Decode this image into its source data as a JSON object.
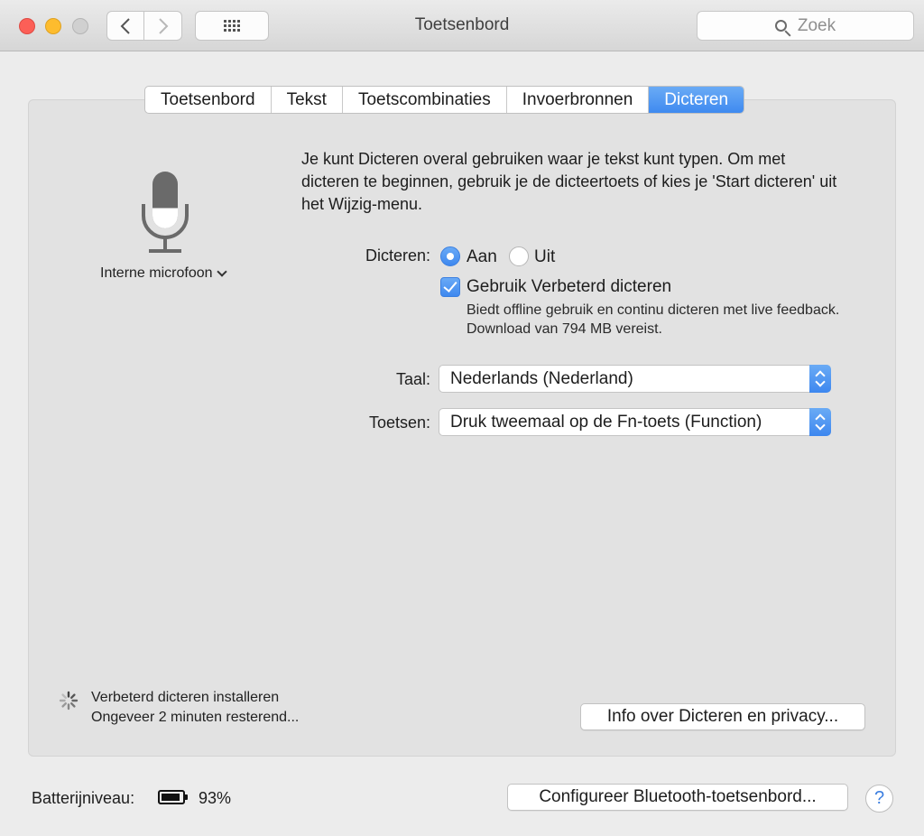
{
  "window": {
    "title": "Toetsenbord"
  },
  "search": {
    "placeholder": "Zoek"
  },
  "tabs": [
    {
      "label": "Toetsenbord",
      "active": false
    },
    {
      "label": "Tekst",
      "active": false
    },
    {
      "label": "Toetscombinaties",
      "active": false
    },
    {
      "label": "Invoerbronnen",
      "active": false
    },
    {
      "label": "Dicteren",
      "active": true
    }
  ],
  "mic": {
    "label": "Interne microfoon"
  },
  "description": "Je kunt Dicteren overal gebruiken waar je tekst kunt typen. Om met dicteren te beginnen, gebruik je de dicteertoets of kies je 'Start dicteren' uit het Wijzig-menu.",
  "dictation": {
    "label": "Dicteren:",
    "on_label": "Aan",
    "off_label": "Uit",
    "selected": "Aan"
  },
  "enhanced": {
    "label": "Gebruik Verbeterd dicteren",
    "checked": true,
    "note": "Biedt offline gebruik en continu dicteren met live feedback. Download van 794 MB vereist."
  },
  "language": {
    "label": "Taal:",
    "value": "Nederlands (Nederland)"
  },
  "shortcut": {
    "label": "Toetsen:",
    "value": "Druk tweemaal op de Fn-toets (Function)"
  },
  "status": {
    "line1": "Verbeterd dicteren installeren",
    "line2": "Ongeveer 2 minuten resterend..."
  },
  "buttons": {
    "privacy": "Info over Dicteren en privacy...",
    "bluetooth": "Configureer Bluetooth-toetsenbord...",
    "help": "?"
  },
  "battery": {
    "label": "Batterijniveau:",
    "percent": "93%"
  },
  "colors": {
    "accent": "#3e88ef",
    "background": "#ececec",
    "panel": "#e2e2e2"
  }
}
